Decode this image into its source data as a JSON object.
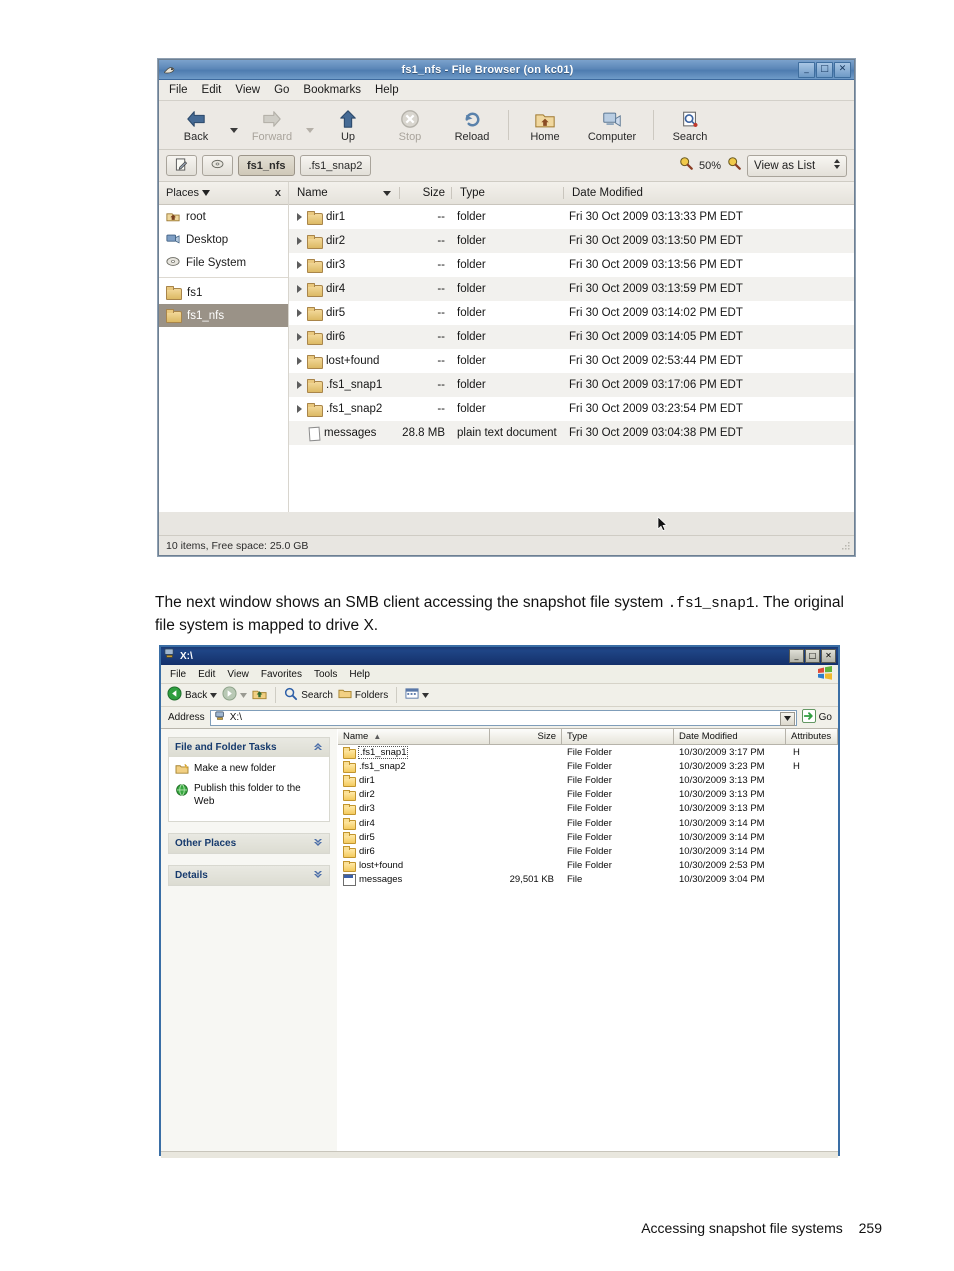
{
  "gnome_window": {
    "title": "fs1_nfs - File Browser (on kc01)",
    "titlebar_icon": "file-browser-icon",
    "window_buttons": {
      "minimize": "_",
      "maximize": "□",
      "close": "✕"
    },
    "menus": [
      "File",
      "Edit",
      "View",
      "Go",
      "Bookmarks",
      "Help"
    ],
    "toolbar": [
      {
        "label": "Back",
        "icon": "back-arrow-icon",
        "enabled": true,
        "has_dropdown": true
      },
      {
        "label": "Forward",
        "icon": "forward-arrow-icon",
        "enabled": false,
        "has_dropdown": true
      },
      {
        "label": "Up",
        "icon": "up-arrow-icon",
        "enabled": true
      },
      {
        "label": "Stop",
        "icon": "stop-icon",
        "enabled": false
      },
      {
        "label": "Reload",
        "icon": "reload-icon",
        "enabled": true
      },
      {
        "label": "Home",
        "icon": "home-folder-icon",
        "enabled": true
      },
      {
        "label": "Computer",
        "icon": "computer-icon",
        "enabled": true
      },
      {
        "label": "Search",
        "icon": "search-icon",
        "enabled": true
      }
    ],
    "pathbar": {
      "edit_location_icon": "edit-location-icon",
      "disc_icon": "disc-icon",
      "crumbs": [
        {
          "label": "fs1_nfs",
          "active": true
        },
        {
          "label": ".fs1_snap2",
          "active": false
        }
      ],
      "zoom_out_icon": "zoom-out-icon",
      "zoom_level": "50%",
      "zoom_in_icon": "zoom-in-icon",
      "view_mode": "View as List"
    },
    "places": {
      "header": "Places",
      "close_label": "x",
      "items": [
        {
          "label": "root",
          "icon": "home-user-icon",
          "selected": false
        },
        {
          "label": "Desktop",
          "icon": "desktop-icon",
          "selected": false
        },
        {
          "label": "File System",
          "icon": "filesystem-disk-icon",
          "selected": false
        },
        {
          "label": "fs1",
          "icon": "folder-icon",
          "selected": false
        },
        {
          "label": "fs1_nfs",
          "icon": "folder-icon",
          "selected": true
        }
      ]
    },
    "file_list": {
      "columns": [
        "Name",
        "Size",
        "Type",
        "Date Modified"
      ],
      "sort_column": "Name",
      "rows": [
        {
          "name": "dir1",
          "size": "--",
          "type": "folder",
          "date": "Fri 30 Oct 2009 03:13:33 PM EDT",
          "icon": "folder-icon",
          "expandable": true
        },
        {
          "name": "dir2",
          "size": "--",
          "type": "folder",
          "date": "Fri 30 Oct 2009 03:13:50 PM EDT",
          "icon": "folder-icon",
          "expandable": true
        },
        {
          "name": "dir3",
          "size": "--",
          "type": "folder",
          "date": "Fri 30 Oct 2009 03:13:56 PM EDT",
          "icon": "folder-icon",
          "expandable": true
        },
        {
          "name": "dir4",
          "size": "--",
          "type": "folder",
          "date": "Fri 30 Oct 2009 03:13:59 PM EDT",
          "icon": "folder-icon",
          "expandable": true
        },
        {
          "name": "dir5",
          "size": "--",
          "type": "folder",
          "date": "Fri 30 Oct 2009 03:14:02 PM EDT",
          "icon": "folder-icon",
          "expandable": true
        },
        {
          "name": "dir6",
          "size": "--",
          "type": "folder",
          "date": "Fri 30 Oct 2009 03:14:05 PM EDT",
          "icon": "folder-icon",
          "expandable": true
        },
        {
          "name": "lost+found",
          "size": "--",
          "type": "folder",
          "date": "Fri 30 Oct 2009 02:53:44 PM EDT",
          "icon": "folder-icon",
          "expandable": true
        },
        {
          "name": ".fs1_snap1",
          "size": "--",
          "type": "folder",
          "date": "Fri 30 Oct 2009 03:17:06 PM EDT",
          "icon": "folder-icon",
          "expandable": true
        },
        {
          "name": ".fs1_snap2",
          "size": "--",
          "type": "folder",
          "date": "Fri 30 Oct 2009 03:23:54 PM EDT",
          "icon": "folder-icon",
          "expandable": true
        },
        {
          "name": "messages",
          "size": "28.8 MB",
          "type": "plain text document",
          "date": "Fri 30 Oct 2009 03:04:38 PM EDT",
          "icon": "text-document-icon",
          "expandable": false
        }
      ]
    },
    "status": "10 items, Free space: 25.0 GB"
  },
  "paragraph": {
    "part1": "The next window shows an SMB client accessing the snapshot file system ",
    "code1": ".fs1_snap1",
    "part2": ". The original file system is mapped to drive X."
  },
  "xp_window": {
    "title": "X:\\",
    "titlebar_icon": "network-drive-icon",
    "window_buttons": {
      "minimize": "_",
      "maximize": "□",
      "close": "✕"
    },
    "menus": [
      "File",
      "Edit",
      "View",
      "Favorites",
      "Tools",
      "Help"
    ],
    "brand_icon": "windows-flag-icon",
    "toolbar": {
      "back_label": "Back",
      "back_icon": "back-circle-icon",
      "back_dropdown_icon": "chevron-down-icon",
      "forward_icon": "forward-circle-icon",
      "forward_dropdown_icon": "chevron-down-icon",
      "up_icon": "up-folder-icon",
      "search_label": "Search",
      "search_icon": "search-icon",
      "folders_label": "Folders",
      "folders_icon": "folders-icon",
      "views_icon": "views-icon",
      "views_dropdown_icon": "chevron-down-icon"
    },
    "address": {
      "label": "Address",
      "icon": "network-drive-icon",
      "value": "X:\\",
      "dropdown_icon": "chevron-down-icon",
      "go_label": "Go",
      "go_icon": "go-arrow-icon"
    },
    "task_panels": [
      {
        "title": "File and Folder Tasks",
        "chevron": "chevron-up-icon",
        "collapsed": false,
        "tasks": [
          {
            "label": "Make a new folder",
            "icon": "new-folder-icon"
          },
          {
            "label": "Publish this folder to the Web",
            "icon": "publish-web-icon"
          }
        ]
      },
      {
        "title": "Other Places",
        "chevron": "chevron-down-icon",
        "collapsed": true,
        "tasks": []
      },
      {
        "title": "Details",
        "chevron": "chevron-down-icon",
        "collapsed": true,
        "tasks": []
      }
    ],
    "file_list": {
      "columns": [
        "Name",
        "Size",
        "Type",
        "Date Modified",
        "Attributes"
      ],
      "sort_column": "Name",
      "sort_direction": "asc",
      "rows": [
        {
          "name": ".fs1_snap1",
          "size": "",
          "type": "File Folder",
          "date": "10/30/2009 3:17 PM",
          "attributes": "H",
          "icon": "folder-icon",
          "focused": true
        },
        {
          "name": ".fs1_snap2",
          "size": "",
          "type": "File Folder",
          "date": "10/30/2009 3:23 PM",
          "attributes": "H",
          "icon": "folder-icon",
          "focused": false
        },
        {
          "name": "dir1",
          "size": "",
          "type": "File Folder",
          "date": "10/30/2009 3:13 PM",
          "attributes": "",
          "icon": "folder-icon",
          "focused": false
        },
        {
          "name": "dir2",
          "size": "",
          "type": "File Folder",
          "date": "10/30/2009 3:13 PM",
          "attributes": "",
          "icon": "folder-icon",
          "focused": false
        },
        {
          "name": "dir3",
          "size": "",
          "type": "File Folder",
          "date": "10/30/2009 3:13 PM",
          "attributes": "",
          "icon": "folder-icon",
          "focused": false
        },
        {
          "name": "dir4",
          "size": "",
          "type": "File Folder",
          "date": "10/30/2009 3:14 PM",
          "attributes": "",
          "icon": "folder-icon",
          "focused": false
        },
        {
          "name": "dir5",
          "size": "",
          "type": "File Folder",
          "date": "10/30/2009 3:14 PM",
          "attributes": "",
          "icon": "folder-icon",
          "focused": false
        },
        {
          "name": "dir6",
          "size": "",
          "type": "File Folder",
          "date": "10/30/2009 3:14 PM",
          "attributes": "",
          "icon": "folder-icon",
          "focused": false
        },
        {
          "name": "lost+found",
          "size": "",
          "type": "File Folder",
          "date": "10/30/2009 2:53 PM",
          "attributes": "",
          "icon": "folder-icon",
          "focused": false
        },
        {
          "name": "messages",
          "size": "29,501 KB",
          "type": "File",
          "date": "10/30/2009 3:04 PM",
          "attributes": "",
          "icon": "file-icon",
          "focused": false
        }
      ]
    }
  },
  "footer": {
    "section": "Accessing snapshot file systems",
    "page": "259"
  },
  "colors": {
    "gnome_titlebar": "#5c87b8",
    "gnome_chrome": "#ece9e4",
    "places_selected": "#9a9287",
    "xp_titlebar": "#1f4586",
    "xp_border": "#3a6ea5",
    "xp_task_header_text": "#163a6d",
    "row_alt": "#f2f1ee"
  }
}
